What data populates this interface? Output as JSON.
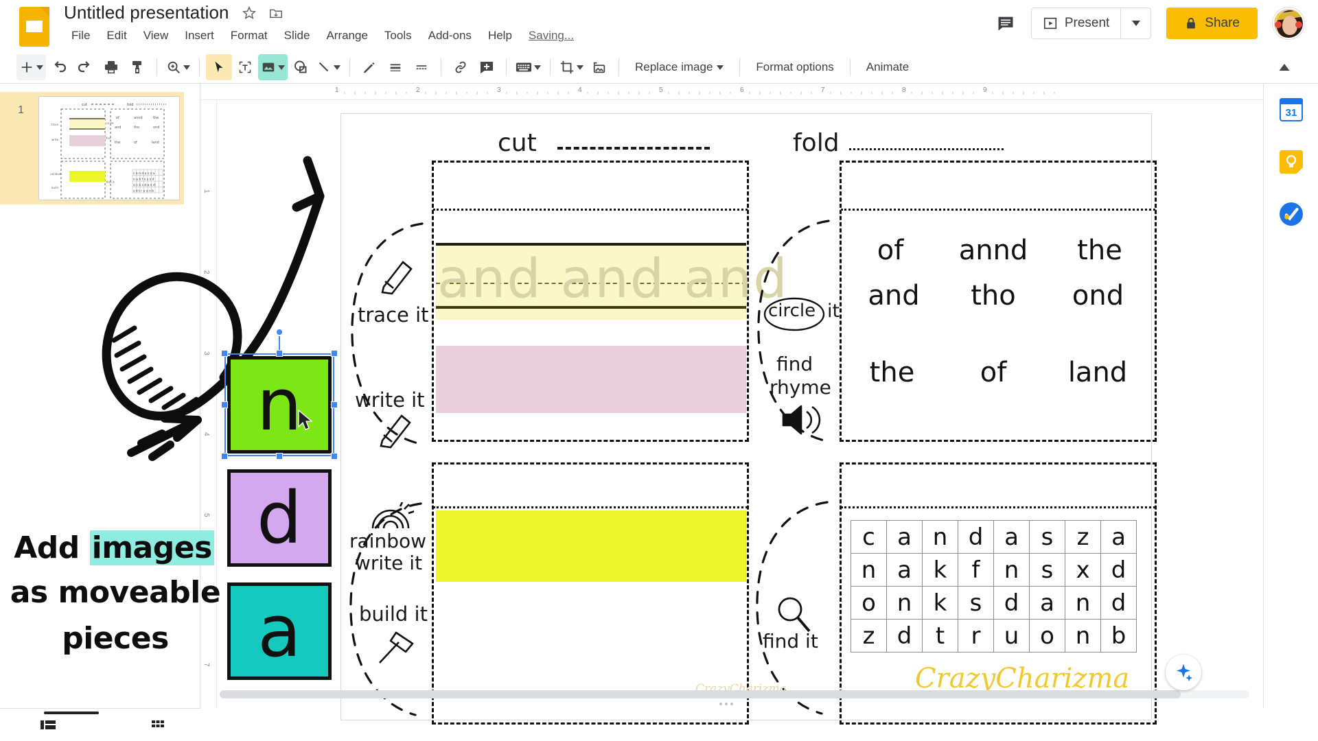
{
  "app": {
    "name": "Google Slides",
    "doc_title": "Untitled presentation",
    "saving_status": "Saving...",
    "logo_icon": "slides-logo-icon",
    "star_icon": "star-icon",
    "move-to-folder_icon": "move-to-folder-icon"
  },
  "menu": {
    "items": [
      {
        "label": "File"
      },
      {
        "label": "Edit"
      },
      {
        "label": "View"
      },
      {
        "label": "Insert"
      },
      {
        "label": "Format"
      },
      {
        "label": "Slide"
      },
      {
        "label": "Arrange"
      },
      {
        "label": "Tools"
      },
      {
        "label": "Add-ons"
      },
      {
        "label": "Help"
      }
    ]
  },
  "header_actions": {
    "comment_icon": "comment-icon",
    "present_label": "Present",
    "present_icon": "present-icon",
    "present_caret_icon": "chevron-down-icon",
    "share_label": "Share",
    "share_lock_icon": "lock-icon",
    "avatar_label": "account-avatar"
  },
  "toolbar": {
    "new_slide_icon": "plus-icon",
    "new_slide_caret_icon": "chevron-down-icon",
    "undo_icon": "undo-icon",
    "redo_icon": "redo-icon",
    "print_icon": "print-icon",
    "paint_format_icon": "paint-format-icon",
    "zoom_icon": "zoom-icon",
    "zoom_caret_icon": "chevron-down-icon",
    "select_icon": "select-arrow-icon",
    "textbox_icon": "text-box-icon",
    "image_icon": "image-icon",
    "image_caret_icon": "chevron-down-icon",
    "shape_icon": "shape-icon",
    "line_icon": "line-icon",
    "line_caret_icon": "chevron-down-icon",
    "pen_icon": "pen-icon",
    "border_weight_icon": "border-weight-icon",
    "border_dash_icon": "border-dash-icon",
    "link_icon": "link-icon",
    "comment_add_icon": "add-comment-icon",
    "speaker_notes_icon": "keyboard-icon",
    "speaker_notes_caret_icon": "chevron-down-icon",
    "crop_icon": "crop-icon",
    "crop_caret_icon": "chevron-down-icon",
    "mask_icon": "image-mask-icon",
    "replace_image_label": "Replace image",
    "replace_image_caret_icon": "chevron-down-icon",
    "format_options_label": "Format options",
    "animate_label": "Animate",
    "collapse_icon": "chevron-up-icon"
  },
  "filmstrip": {
    "slides": [
      {
        "number": "1",
        "selected": true
      }
    ]
  },
  "ruler": {
    "horizontal_ticks": [
      "1",
      "2",
      "3",
      "4",
      "5",
      "6",
      "7",
      "8",
      "9"
    ],
    "vertical_ticks": [
      "1",
      "2",
      "3",
      "4",
      "5",
      "6",
      "7"
    ]
  },
  "slide": {
    "headers": [
      {
        "label": "cut",
        "line_style": "dashed"
      },
      {
        "label": "fold",
        "line_style": "dotted"
      }
    ],
    "left_column": {
      "activities": [
        {
          "label": "trace it",
          "icon": "pencil-icon"
        },
        {
          "label": "write it",
          "icon": "pencil-icon"
        },
        {
          "label": "rainbow write it",
          "icon": "rainbow-icon"
        },
        {
          "label": "build it",
          "icon": "hammer-icon"
        }
      ],
      "trace_text": "and  and  and",
      "trace_band_color": "#FAF8C8",
      "write_band_color": "#E8D0DA",
      "rainbow_band_color": "#EDF52B"
    },
    "right_column": {
      "activities": [
        {
          "label": "circle it",
          "icon": "circle-icon"
        },
        {
          "label": "find rhyme",
          "icon": "speaker-icon"
        },
        {
          "label": "find it",
          "icon": "magnifier-icon"
        }
      ],
      "word_grid": [
        [
          "of",
          "annd",
          "the"
        ],
        [
          "and",
          "tho",
          "ond"
        ],
        [
          "the",
          "of",
          "land"
        ]
      ],
      "letter_grid": [
        [
          "c",
          "a",
          "n",
          "d",
          "a",
          "s",
          "z",
          "a"
        ],
        [
          "n",
          "a",
          "k",
          "f",
          "n",
          "s",
          "x",
          "d"
        ],
        [
          "o",
          "n",
          "k",
          "s",
          "d",
          "a",
          "n",
          "d"
        ],
        [
          "z",
          "d",
          "t",
          "r",
          "u",
          "o",
          "n",
          "b"
        ]
      ]
    },
    "watermark_small": "CrazyCharizma",
    "watermark_large": "CrazyCharizma"
  },
  "letter_tiles": [
    {
      "letter": "n",
      "color": "#7CE617",
      "selected": true
    },
    {
      "letter": "d",
      "color": "#D4A8EE",
      "selected": false
    },
    {
      "letter": "a",
      "color": "#16C9BE",
      "selected": false
    }
  ],
  "annotation": {
    "line1_a": "Add ",
    "line1_b": "images",
    "line2": "as moveable",
    "line3": "pieces",
    "highlight_color": "#8EEDE0",
    "arrow_icon": "curved-arrow-icon"
  },
  "right_rail": {
    "items": [
      {
        "name": "calendar",
        "icon": "calendar-icon",
        "badge": "31"
      },
      {
        "name": "keep",
        "icon": "keep-icon"
      },
      {
        "name": "tasks",
        "icon": "tasks-icon"
      }
    ]
  },
  "bottom_bar": {
    "speaker_notes_icon": "speaker-notes-icon",
    "grid_view_icon": "grid-view-icon",
    "explore_icon": "explore-icon"
  },
  "colors": {
    "brand_yellow": "#FBBC04",
    "accent_blue": "#4285F4",
    "selected_row": "#FCE8B2",
    "toolbar_active_teal": "#9AE6D4"
  }
}
